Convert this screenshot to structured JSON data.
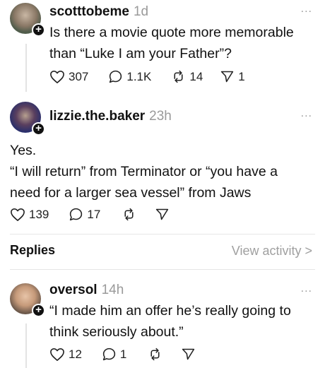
{
  "posts": [
    {
      "username": "scotttobeme",
      "time": "1d",
      "more": "...",
      "lines": [
        "Is there a movie quote more memorable",
        "than “Luke I am your Father”?"
      ],
      "likes": "307",
      "comments": "1.1K",
      "reposts": "14",
      "shares": "1"
    },
    {
      "username": "lizzie.the.baker",
      "time": "23h",
      "more": "...",
      "lines": [
        "Yes.",
        "“I will return” from Terminator or “you have  a",
        "need for a larger sea vessel” from Jaws"
      ],
      "likes": "139",
      "comments": "17"
    }
  ],
  "replies_header": {
    "label": "Replies",
    "view_activity": "View activity >"
  },
  "reply": {
    "username": "oversol",
    "time": "14h",
    "more": "...",
    "lines": [
      "“I made him an offer he’s really going to",
      "think seriously about.”"
    ],
    "likes": "12",
    "comments": "1"
  },
  "icons": {
    "heart": "heart-icon",
    "comment": "comment-icon",
    "repost": "repost-icon",
    "share": "share-icon",
    "follow": "plus-icon"
  }
}
